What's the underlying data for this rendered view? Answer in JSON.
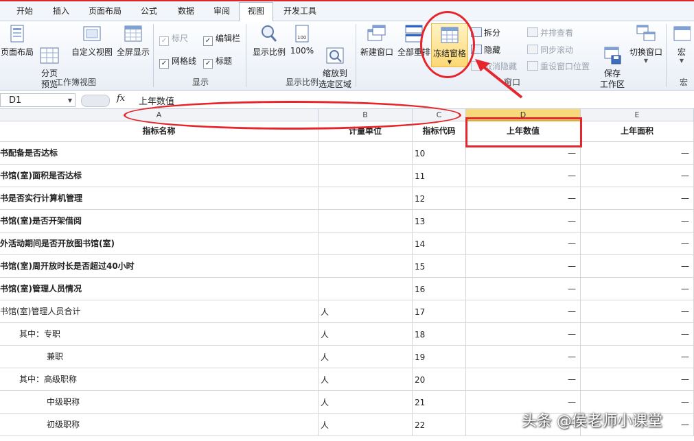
{
  "tabs": [
    "开始",
    "插入",
    "页面布局",
    "公式",
    "数据",
    "审阅",
    "视图",
    "开发工具"
  ],
  "active_tab": "视图",
  "ribbon": {
    "workbook_views": {
      "label": "工作簿视图",
      "page_layout": "页面布局",
      "page_break": "分页\n预览",
      "custom_view": "自定义视图",
      "full_screen": "全屏显示"
    },
    "show": {
      "label": "显示",
      "ruler": "标尺",
      "formula_bar": "编辑栏",
      "gridlines": "网格线",
      "headings": "标题"
    },
    "zoom": {
      "label": "显示比例",
      "zoom": "显示比例",
      "hundred": "100%",
      "zoom_selection": "缩放到\n选定区域"
    },
    "window": {
      "label": "窗口",
      "new_window": "新建窗口",
      "arrange_all": "全部重排",
      "freeze_panes": "冻结窗格",
      "split": "拆分",
      "hide": "隐藏",
      "unhide": "取消隐藏",
      "view_side": "并排查看",
      "sync_scroll": "同步滚动",
      "reset_pos": "重设窗口位置",
      "save_workspace": "保存\n工作区",
      "switch_windows": "切换窗口"
    },
    "macros": {
      "label": "宏",
      "macros": "宏"
    }
  },
  "formula_bar": {
    "name_box": "D1",
    "fx": "fx",
    "value": "上年数值"
  },
  "columns": [
    "A",
    "B",
    "C",
    "D",
    "E"
  ],
  "header_row": [
    "指标名称",
    "计量单位",
    "指标代码",
    "上年数值",
    "上年面积"
  ],
  "rows": [
    {
      "name": "书配备是否达标",
      "unit": "",
      "code": "10",
      "d": "—",
      "e": "—",
      "bold": true
    },
    {
      "name": "书馆(室)面积是否达标",
      "unit": "",
      "code": "11",
      "d": "—",
      "e": "—",
      "bold": true
    },
    {
      "name": "书是否实行计算机管理",
      "unit": "",
      "code": "12",
      "d": "—",
      "e": "—",
      "bold": true
    },
    {
      "name": "书馆(室)是否开架借阅",
      "unit": "",
      "code": "13",
      "d": "—",
      "e": "—",
      "bold": true
    },
    {
      "name": "外活动期间是否开放图书馆(室)",
      "unit": "",
      "code": "14",
      "d": "—",
      "e": "—",
      "bold": true
    },
    {
      "name": "书馆(室)周开放时长是否超过40小时",
      "unit": "",
      "code": "15",
      "d": "—",
      "e": "—",
      "bold": true
    },
    {
      "name": "书馆(室)管理人员情况",
      "unit": "",
      "code": "16",
      "d": "—",
      "e": "—",
      "bold": true
    },
    {
      "name": "书馆(室)管理人员合计",
      "unit": "人",
      "code": "17",
      "d": "—",
      "e": "—",
      "bold": false
    },
    {
      "name": "其中：专职",
      "unit": "人",
      "code": "18",
      "d": "—",
      "e": "—",
      "bold": false,
      "indent": 1
    },
    {
      "name": "兼职",
      "unit": "人",
      "code": "19",
      "d": "—",
      "e": "—",
      "bold": false,
      "indent": 2
    },
    {
      "name": "其中：高级职称",
      "unit": "人",
      "code": "20",
      "d": "—",
      "e": "—",
      "bold": false,
      "indent": 1
    },
    {
      "name": "中级职称",
      "unit": "人",
      "code": "21",
      "d": "—",
      "e": "—",
      "bold": false,
      "indent": 2
    },
    {
      "name": "初级职称",
      "unit": "人",
      "code": "22",
      "d": "—",
      "e": "—",
      "bold": false,
      "indent": 2
    }
  ],
  "watermark": "头条 @侯老师小课堂",
  "colors": {
    "accent_red": "#e5262c",
    "selected_header": "#f8d979",
    "ribbon_bg": "#e9eef6"
  }
}
